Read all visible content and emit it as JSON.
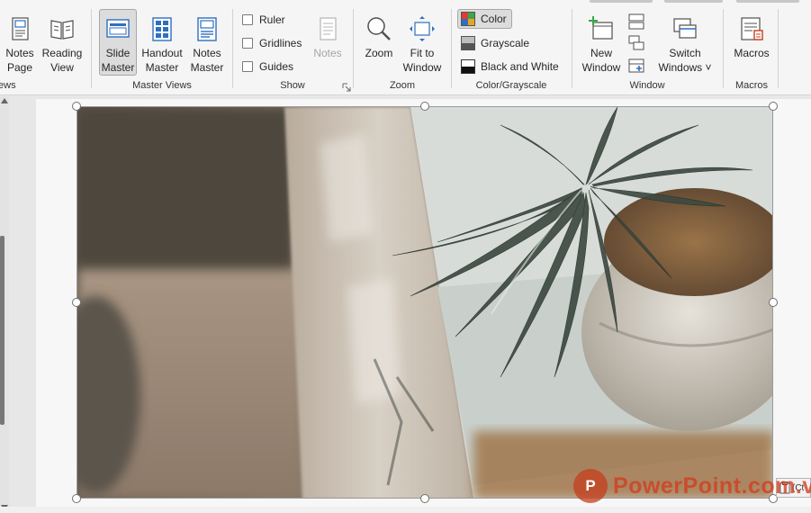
{
  "ribbon": {
    "views_group": {
      "label": "Views",
      "notes_page": "Notes\nPage",
      "reading_view": "Reading\nView"
    },
    "master_views": {
      "label": "Master Views",
      "slide_master": "Slide\nMaster",
      "handout_master": "Handout\nMaster",
      "notes_master": "Notes\nMaster"
    },
    "show": {
      "label": "Show",
      "ruler": "Ruler",
      "gridlines": "Gridlines",
      "guides": "Guides",
      "notes": "Notes"
    },
    "zoom": {
      "label": "Zoom",
      "zoom": "Zoom",
      "fit_to_window": "Fit to\nWindow"
    },
    "color_grayscale": {
      "label": "Color/Grayscale",
      "color": "Color",
      "grayscale": "Grayscale",
      "black_and_white": "Black and White"
    },
    "window": {
      "label": "Window",
      "new_window": "New\nWindow",
      "switch_windows": "Switch\nWindows ˅"
    },
    "macros": {
      "label": "Macros",
      "macros": "Macros"
    }
  },
  "paste_options": "(Ct",
  "watermark": {
    "logo_text": "P",
    "text": "PowerPoint.com.vn"
  },
  "colors": {
    "ribbon_bg": "#f5f5f5",
    "pressed_bg": "#dcdcdc",
    "icon_blue": "#2f6fbf",
    "accent_red": "#c43e1c"
  }
}
